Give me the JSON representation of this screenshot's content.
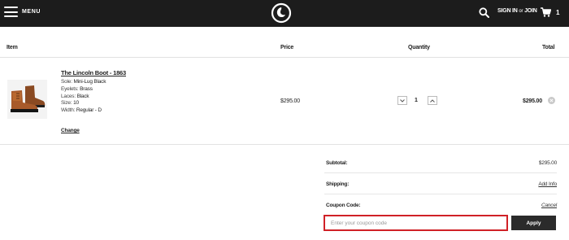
{
  "header": {
    "menu_label": "MENU",
    "signin_label": "SIGN IN",
    "or_label": "or",
    "join_label": "JOIN",
    "cart_count": "1"
  },
  "table": {
    "col_item": "Item",
    "col_price": "Price",
    "col_quantity": "Quantity",
    "col_total": "Total"
  },
  "product": {
    "name": "The Lincoln Boot - 1863",
    "specs": [
      {
        "label": "Sole:",
        "value": "Mini-Lug Black"
      },
      {
        "label": "Eyelets:",
        "value": "Brass"
      },
      {
        "label": "Laces:",
        "value": "Black"
      },
      {
        "label": "Size:",
        "value": "10"
      },
      {
        "label": "Width:",
        "value": "Regular - D"
      }
    ],
    "change_label": "Change",
    "price": "$295.00",
    "quantity": "1",
    "total": "$295.00"
  },
  "summary": {
    "subtotal_label": "Subtotal:",
    "subtotal_value": "$295.00",
    "shipping_label": "Shipping:",
    "shipping_link": "Add Info",
    "coupon_label": "Coupon Code:",
    "cancel_link": "Cancel",
    "coupon_placeholder": "Enter your coupon code",
    "coupon_value": "",
    "apply_label": "Apply"
  },
  "colors": {
    "header_bg": "#1c1c1c",
    "highlight_border": "#d02127",
    "apply_bg": "#2b2b2b"
  },
  "icons": {
    "menu": "hamburger-icon",
    "logo": "brand-logo",
    "search": "search-icon",
    "cart": "cart-icon",
    "remove": "close-icon",
    "qty_down": "chevron-down-icon",
    "qty_up": "chevron-up-icon"
  }
}
